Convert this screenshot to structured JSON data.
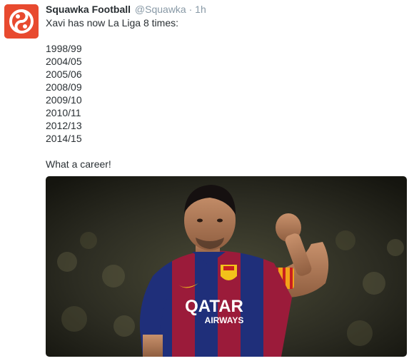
{
  "tweet": {
    "display_name": "Squawka Football",
    "handle": "@Squawka",
    "separator": "·",
    "time": "1h",
    "intro": "Xavi has now La Liga 8 times:",
    "seasons": [
      "1998/99",
      "2004/05",
      "2005/06",
      "2008/09",
      "2009/10",
      "2010/11",
      "2012/13",
      "2014/15"
    ],
    "closing": "What a career!"
  },
  "photo": {
    "shirt_text_line1": "QATAR",
    "shirt_text_line2": "AIRWAYS"
  },
  "colors": {
    "avatar_bg": "#e84a2f",
    "name": "#292f33",
    "meta": "#8899a6",
    "shirt_blue": "#1f2f7a",
    "shirt_red": "#9b1b3a",
    "armband": "#f2a21a"
  },
  "icons": {
    "avatar": "squawka-logo-icon"
  }
}
